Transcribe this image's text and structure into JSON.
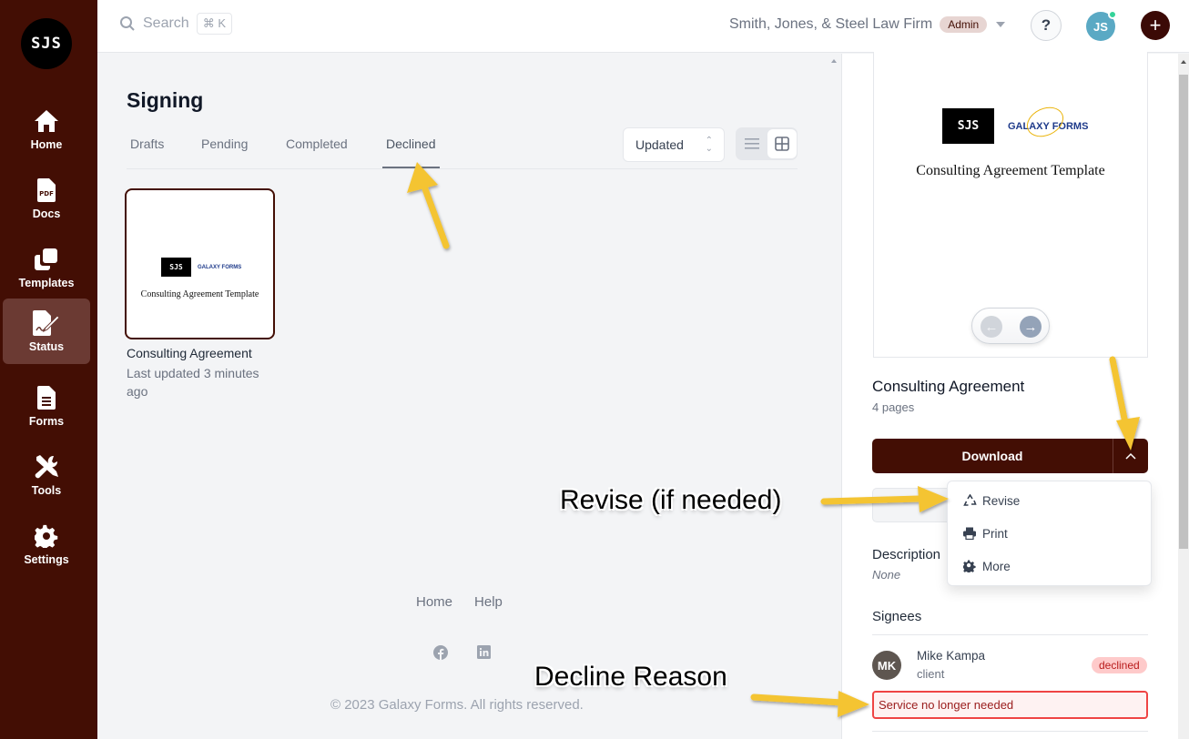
{
  "sidebar": {
    "logo": "SJS",
    "items": [
      {
        "label": "Home",
        "icon": "home-icon"
      },
      {
        "label": "Docs",
        "icon": "pdf-file-icon"
      },
      {
        "label": "Templates",
        "icon": "templates-icon"
      },
      {
        "label": "Status",
        "icon": "signature-icon",
        "active": true
      },
      {
        "label": "Forms",
        "icon": "form-file-icon"
      },
      {
        "label": "Tools",
        "icon": "tools-icon"
      },
      {
        "label": "Settings",
        "icon": "gear-icon"
      }
    ]
  },
  "topbar": {
    "search_placeholder": "Search",
    "search_shortcut": "⌘ K",
    "firm_name": "Smith, Jones, & Steel Law Firm",
    "role_badge": "Admin",
    "help_label": "?",
    "user_initials": "JS",
    "add_label": "+"
  },
  "main": {
    "title": "Signing",
    "tabs": [
      {
        "label": "Drafts"
      },
      {
        "label": "Pending"
      },
      {
        "label": "Completed"
      },
      {
        "label": "Declined",
        "active": true
      }
    ],
    "sort": {
      "selected": "Updated"
    },
    "view_mode": "grid",
    "documents": [
      {
        "thumb_logo_left": "SJS",
        "thumb_logo_right": "GALAXY FORMS",
        "thumb_title": "Consulting Agreement Template",
        "name": "Consulting Agreement",
        "updated": "Last updated 3 minutes ago"
      }
    ],
    "footer": {
      "links": [
        "Home",
        "Help"
      ],
      "social": [
        "facebook-icon",
        "linkedin-icon"
      ],
      "copyright": "© 2023 Galaxy Forms. All rights reserved."
    }
  },
  "panel": {
    "preview": {
      "logo_left": "SJS",
      "logo_right": "GALAXY FORMS",
      "title": "Consulting Agreement Template"
    },
    "doc_title": "Consulting Agreement",
    "pages": "4 pages",
    "download_label": "Download",
    "menu": [
      {
        "label": "Revise",
        "icon": "recycle-icon"
      },
      {
        "label": "Print",
        "icon": "printer-icon"
      },
      {
        "label": "More",
        "icon": "gear-icon"
      }
    ],
    "description_label": "Description",
    "description_value": "None",
    "signees_label": "Signees",
    "signees": [
      {
        "initials": "MK",
        "name": "Mike Kampa",
        "role": "client",
        "status": "declined",
        "decline_reason": "Service no longer needed"
      }
    ]
  },
  "annotations": {
    "revise": "Revise (if needed)",
    "decline": "Decline Reason",
    "arrow_color": "#f4c430"
  }
}
